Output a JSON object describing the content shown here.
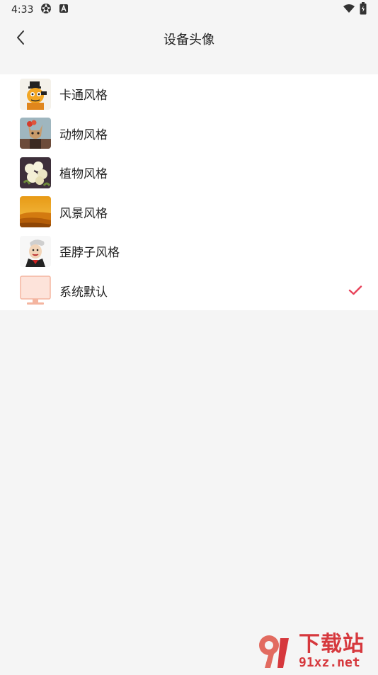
{
  "status_bar": {
    "time": "4:33"
  },
  "header": {
    "title": "设备头像",
    "back_icon": "chevron-left-icon"
  },
  "avatar_styles": [
    {
      "label": "卡通风格",
      "icon": "cartoon-avatar-thumbnail"
    },
    {
      "label": "动物风格",
      "icon": "animal-avatar-thumbnail"
    },
    {
      "label": "植物风格",
      "icon": "plant-avatar-thumbnail"
    },
    {
      "label": "风景风格",
      "icon": "landscape-avatar-thumbnail"
    },
    {
      "label": "歪脖子风格",
      "icon": "crooked-neck-avatar-thumbnail"
    },
    {
      "label": "系统默认",
      "icon": "default-monitor-thumbnail",
      "selected": true
    }
  ],
  "watermark": {
    "top_text": "下载站",
    "bottom_text": "91xz.net"
  },
  "colors": {
    "background": "#f5f5f5",
    "list_bg": "#ffffff",
    "accent": "#e8435a",
    "watermark": "#d6383d"
  }
}
